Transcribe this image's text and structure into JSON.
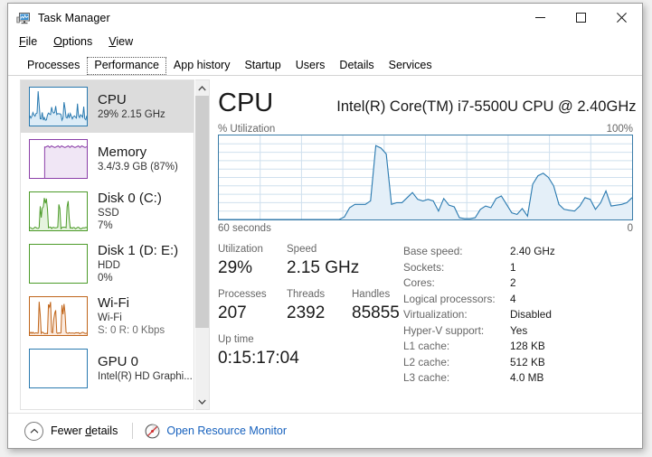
{
  "window": {
    "title": "Task Manager",
    "icon": "task-manager-icon",
    "controls": {
      "minimize": "—",
      "maximize": "□",
      "close": "✕"
    }
  },
  "menu": {
    "items": [
      {
        "label": "File",
        "accel": "F"
      },
      {
        "label": "Options",
        "accel": "O"
      },
      {
        "label": "View",
        "accel": "V"
      }
    ]
  },
  "tabs": {
    "items": [
      {
        "label": "Processes",
        "active": false
      },
      {
        "label": "Performance",
        "active": true
      },
      {
        "label": "App history",
        "active": false
      },
      {
        "label": "Startup",
        "active": false
      },
      {
        "label": "Users",
        "active": false
      },
      {
        "label": "Details",
        "active": false
      },
      {
        "label": "Services",
        "active": false
      }
    ]
  },
  "sidebar": {
    "items": [
      {
        "name": "CPU",
        "line2": "29%  2.15 GHz",
        "line3": "",
        "selected": true,
        "color": "#2a7ab0",
        "fill": "#dcecf7"
      },
      {
        "name": "Memory",
        "line2": "3.4/3.9 GB (87%)",
        "line3": "",
        "selected": false,
        "color": "#8b3fa8",
        "fill": "#f0e6f5"
      },
      {
        "name": "Disk 0 (C:)",
        "line2": "SSD",
        "line3": "7%",
        "selected": false,
        "color": "#4c9b29",
        "fill": "#e6f3df"
      },
      {
        "name": "Disk 1 (D: E:)",
        "line2": "HDD",
        "line3": "0%",
        "selected": false,
        "color": "#4c9b29",
        "fill": "#ffffff"
      },
      {
        "name": "Wi-Fi",
        "line2": "Wi-Fi",
        "line3": "S: 0 R: 0 Kbps",
        "selected": false,
        "color": "#c0651a",
        "fill": "#fbeade"
      },
      {
        "name": "GPU 0",
        "line2": "Intel(R) HD Graphi...",
        "line3": "",
        "selected": false,
        "color": "#2a7ab0",
        "fill": "#ffffff"
      }
    ]
  },
  "main": {
    "heading": "CPU",
    "model": "Intel(R) Core(TM) i7-5500U CPU @ 2.40GHz",
    "graph_axis_label": "% Utilization",
    "graph_axis_max": "100%",
    "graph_time_left": "60 seconds",
    "graph_time_right": "0",
    "stats": {
      "utilization": {
        "label": "Utilization",
        "value": "29%"
      },
      "speed": {
        "label": "Speed",
        "value": "2.15 GHz"
      },
      "processes": {
        "label": "Processes",
        "value": "207"
      },
      "threads": {
        "label": "Threads",
        "value": "2392"
      },
      "handles": {
        "label": "Handles",
        "value": "85855"
      },
      "uptime": {
        "label": "Up time",
        "value": "0:15:17:04"
      }
    },
    "specs": [
      {
        "key": "Base speed:",
        "value": "2.40 GHz"
      },
      {
        "key": "Sockets:",
        "value": "1"
      },
      {
        "key": "Cores:",
        "value": "2"
      },
      {
        "key": "Logical processors:",
        "value": "4"
      },
      {
        "key": "Virtualization:",
        "value": "Disabled"
      },
      {
        "key": "Hyper-V support:",
        "value": "Yes"
      },
      {
        "key": "L1 cache:",
        "value": "128 KB"
      },
      {
        "key": "L2 cache:",
        "value": "512 KB"
      },
      {
        "key": "L3 cache:",
        "value": "4.0 MB"
      }
    ]
  },
  "footer": {
    "fewer_details": "Fewer details",
    "fewer_details_accel": "d",
    "resource_monitor": "Open Resource Monitor"
  },
  "colors": {
    "cpu_line": "#2a7ab0",
    "cpu_fill": "#e4eff8",
    "grid": "#cfe0ee",
    "link": "#1560bd",
    "selected_bg": "#dcdcdc"
  },
  "chart_data": {
    "type": "area",
    "title": "CPU % Utilization over 60 seconds",
    "xlabel": "60 seconds",
    "ylabel": "% Utilization",
    "ylim": [
      0,
      100
    ],
    "xlim": [
      60,
      0
    ],
    "grid": true,
    "legend": "none",
    "series": [
      {
        "name": "CPU Utilization",
        "values": [
          0,
          0,
          0,
          0,
          0,
          0,
          0,
          0,
          0,
          0,
          0,
          0,
          0,
          0,
          0,
          0,
          0,
          0,
          0,
          0,
          0,
          0,
          0,
          0,
          3,
          14,
          18,
          18,
          18,
          22,
          88,
          85,
          78,
          18,
          20,
          20,
          26,
          32,
          24,
          22,
          24,
          22,
          10,
          25,
          17,
          15,
          2,
          1,
          1,
          2,
          12,
          16,
          14,
          25,
          28,
          18,
          8,
          6,
          13,
          4,
          42,
          52,
          55,
          50,
          40,
          18,
          12,
          11,
          10,
          16,
          26,
          24,
          12,
          20,
          34,
          16,
          17,
          18,
          20,
          26
        ]
      }
    ]
  }
}
